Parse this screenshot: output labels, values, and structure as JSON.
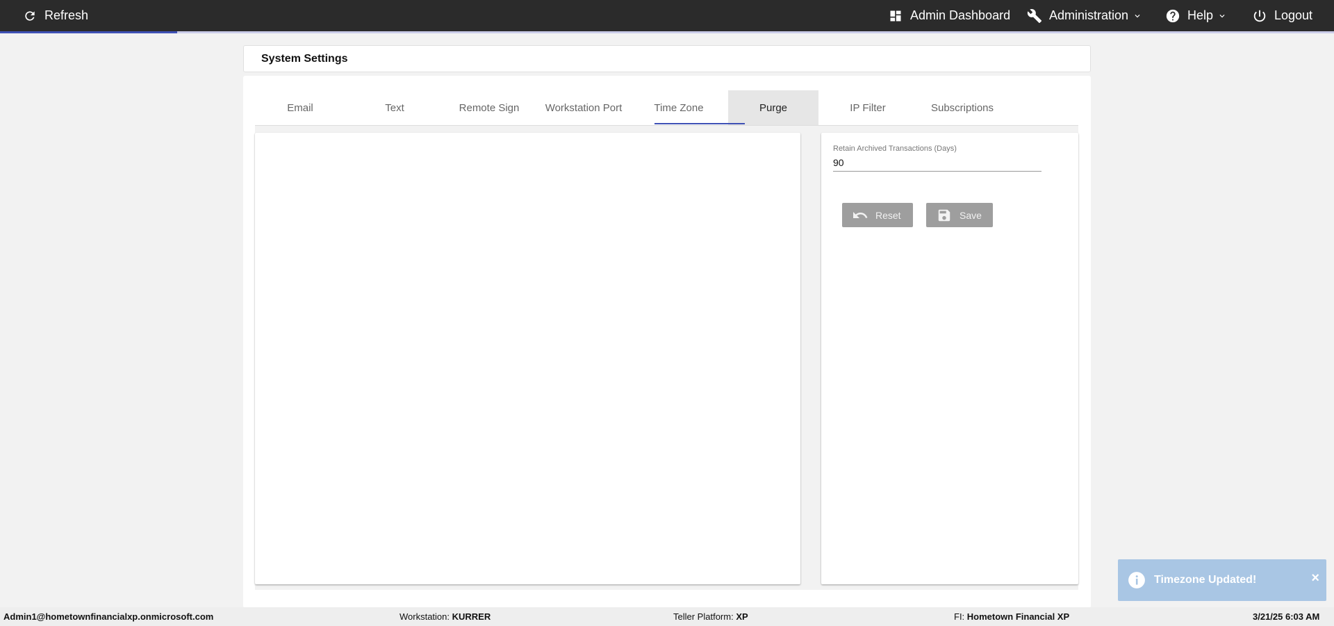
{
  "topbar": {
    "refresh_label": "Refresh",
    "admin_dashboard_label": "Admin Dashboard",
    "administration_label": "Administration",
    "help_label": "Help",
    "logout_label": "Logout",
    "progress_fraction": 0.133,
    "accent_color": "#3f51b5"
  },
  "page": {
    "title": "System Settings"
  },
  "tabs": [
    {
      "label": "Email"
    },
    {
      "label": "Text"
    },
    {
      "label": "Remote Sign"
    },
    {
      "label": "Workstation Port"
    },
    {
      "label": "Time Zone"
    },
    {
      "label": "Purge"
    },
    {
      "label": "IP Filter"
    },
    {
      "label": "Subscriptions"
    }
  ],
  "purge": {
    "retain_label": "Retain Archived Transactions (Days)",
    "retain_value": "90",
    "reset_label": "Reset",
    "save_label": "Save"
  },
  "toast": {
    "message": "Timezone Updated!",
    "close": "×"
  },
  "footer": {
    "user": "Admin1@hometownfinancialxp.onmicrosoft.com",
    "workstation_label": "Workstation: ",
    "workstation_value": "KURRER",
    "platform_label": "Teller Platform: ",
    "platform_value": "XP",
    "fi_label": "FI: ",
    "fi_value": "Hometown Financial XP",
    "datetime": "3/21/25 6:03 AM"
  }
}
